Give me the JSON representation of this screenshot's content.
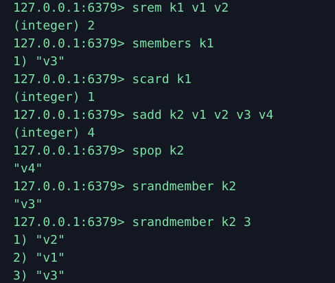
{
  "terminal": {
    "text_color": "#7ee0a6",
    "background_color": "#121722",
    "lines": [
      "127.0.0.1:6379> srem k1 v1 v2",
      "(integer) 2",
      "127.0.0.1:6379> smembers k1",
      "1) \"v3\"",
      "127.0.0.1:6379> scard k1",
      "(integer) 1",
      "127.0.0.1:6379> sadd k2 v1 v2 v3 v4",
      "(integer) 4",
      "127.0.0.1:6379> spop k2",
      "\"v4\"",
      "127.0.0.1:6379> srandmember k2",
      "\"v3\"",
      "127.0.0.1:6379> srandmember k2 3",
      "1) \"v2\"",
      "2) \"v1\"",
      "3) \"v3\""
    ]
  }
}
